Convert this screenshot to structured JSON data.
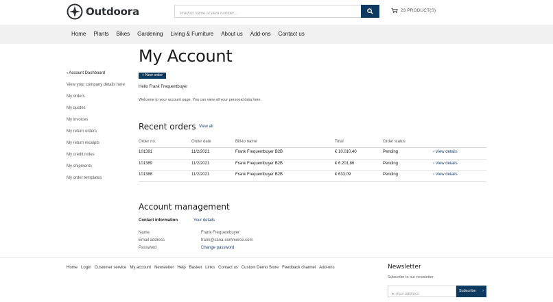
{
  "brand": {
    "name": "Outdoora",
    "accent": "#0f3a5f",
    "link": "#1d3f73"
  },
  "header": {
    "search_placeholder": "Product name or item number...",
    "cart_label": "23 PRODUCT(S)"
  },
  "nav": [
    "Home",
    "Plants",
    "Bikes",
    "Gardening",
    "Living & Furniture",
    "About us",
    "Add-ons",
    "Contact us"
  ],
  "sidebar": [
    "‹ Account Dashboard",
    "View your company details here",
    "My orders",
    "My quotes",
    "My invoices",
    "My return orders",
    "My return receipts",
    "My credit notes",
    "My shipments",
    "My order templates"
  ],
  "main": {
    "title": "My Account",
    "new_order": "+ New order",
    "hello": "Hello Frank Frequentbuyer",
    "welcome": "Welcome to your account page. You can view all your personal data here."
  },
  "recent_orders": {
    "title": "Recent orders",
    "view_all": "View all",
    "columns": [
      "Order no.",
      "Order date",
      "Bill-to name",
      "Total",
      "Order status",
      ""
    ],
    "rows": [
      {
        "no": "101391",
        "date": "11/2/2021",
        "bill_to": "Frank Frequentbuyer B2B",
        "total": "€ 10.010,40",
        "status": "Pending",
        "action": "› View details"
      },
      {
        "no": "101389",
        "date": "11/2/2021",
        "bill_to": "Frank Frequentbuyer B2B",
        "total": "€ 6.201,86",
        "status": "Pending",
        "action": "› View details"
      },
      {
        "no": "101388",
        "date": "11/2/2021",
        "bill_to": "Frank Frequentbuyer B2B",
        "total": "€ 633,09",
        "status": "Pending",
        "action": "› View details"
      }
    ]
  },
  "account_management": {
    "title": "Account management",
    "contact_label": "Contact information",
    "your_details": "Your details",
    "name_label": "Name",
    "name_value": "Frank Frequentbuyer",
    "email_label": "Email address",
    "email_value": "frank@sana-commerce.com",
    "password_label": "Password",
    "password_action": "Change password"
  },
  "footer": {
    "links": [
      "Home",
      "Login",
      "Customer service",
      "My account",
      "Newsletter",
      "Help",
      "Basket",
      "Links",
      "Contact us",
      "Custom Demo Store",
      "Feedback channel",
      "Add-ons"
    ],
    "newsletter_title": "Newsletter",
    "newsletter_sub": "Subscribe to our newsletter.",
    "email_placeholder": "E-mail address",
    "subscribe_label": "Subscribe",
    "subscribe_arrow": "›"
  }
}
